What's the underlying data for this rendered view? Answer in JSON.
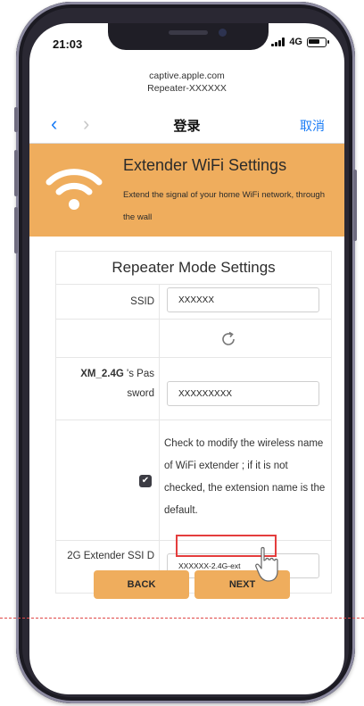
{
  "status_bar": {
    "time": "21:03",
    "network": "4G"
  },
  "browser": {
    "host": "captive.apple.com",
    "page_title": "Repeater-XXXXXX",
    "nav_title": "登录",
    "cancel_label": "取消",
    "back_glyph": "‹",
    "forward_glyph": "›"
  },
  "banner": {
    "title": "Extender WiFi Settings",
    "subtitle": "Extend the signal of your home WiFi network, through the wall",
    "icon": "wifi-icon"
  },
  "form": {
    "heading": "Repeater Mode Settings",
    "ssid_label": "SSID",
    "ssid_value": "XXXXXX",
    "refresh_icon": "refresh-icon",
    "password_label_bold": "XM_2.4G",
    "password_label_rest": " 's Pas sword",
    "password_value": "XXXXXXXXX",
    "checkbox_checked": true,
    "checkbox_glyph": "✔",
    "notice": "Check to modify the wireless name of WiFi extender ; if it is not checked, the extension name is the default.",
    "extender_label": "2G Extender SSI D",
    "extender_value": "XXXXXX-2.4G-ext"
  },
  "buttons": {
    "back": "BACK",
    "next": "NEXT"
  },
  "colors": {
    "accent": "#efad5d",
    "link": "#1a7cf5",
    "highlight": "#e43d3d"
  }
}
